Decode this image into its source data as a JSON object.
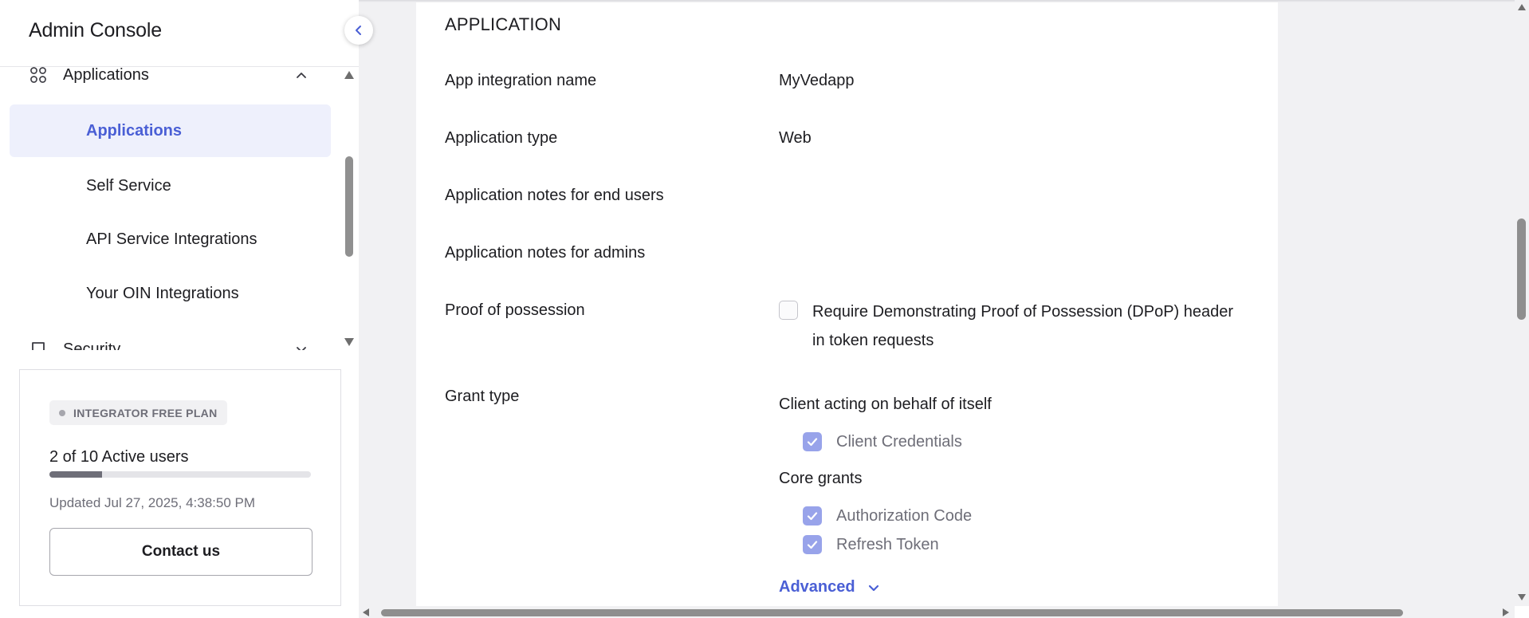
{
  "sidebar": {
    "brand": "Admin Console",
    "groups": [
      {
        "label": "Applications",
        "icon": "grid-icon",
        "expanded": true
      },
      {
        "label": "Security",
        "icon": "shield-icon",
        "expanded": false
      }
    ],
    "items": [
      {
        "label": "Applications",
        "active": true
      },
      {
        "label": "Self Service",
        "active": false
      },
      {
        "label": "API Service Integrations",
        "active": false
      },
      {
        "label": "Your OIN Integrations",
        "active": false
      }
    ]
  },
  "plan": {
    "badge": "INTEGRATOR FREE PLAN",
    "active_users": "2 of 10 Active users",
    "usage_fraction": 0.2,
    "updated": "Updated Jul 27, 2025, 4:38:50 PM",
    "contact_label": "Contact us"
  },
  "main": {
    "section_title": "APPLICATION",
    "rows": [
      {
        "label": "App integration name",
        "value": "MyVedapp"
      },
      {
        "label": "Application type",
        "value": "Web"
      },
      {
        "label": "Application notes for end users",
        "value": ""
      },
      {
        "label": "Application notes for admins",
        "value": ""
      }
    ],
    "proof": {
      "label": "Proof of possession",
      "checkbox_label": "Require Demonstrating Proof of Possession (DPoP) header in token requests",
      "checked": false
    },
    "grant": {
      "label": "Grant type",
      "client_head": "Client acting on behalf of itself",
      "client_options": [
        {
          "label": "Client Credentials",
          "checked": true
        }
      ],
      "core_head": "Core grants",
      "core_options": [
        {
          "label": "Authorization Code",
          "checked": true
        },
        {
          "label": "Refresh Token",
          "checked": true
        }
      ],
      "advanced_label": "Advanced"
    }
  },
  "colors": {
    "accent": "#4a5fd5",
    "active_bg": "#eef0fc",
    "checkbox_checked": "#98a3ea",
    "page_bg": "#f1f1f3"
  }
}
